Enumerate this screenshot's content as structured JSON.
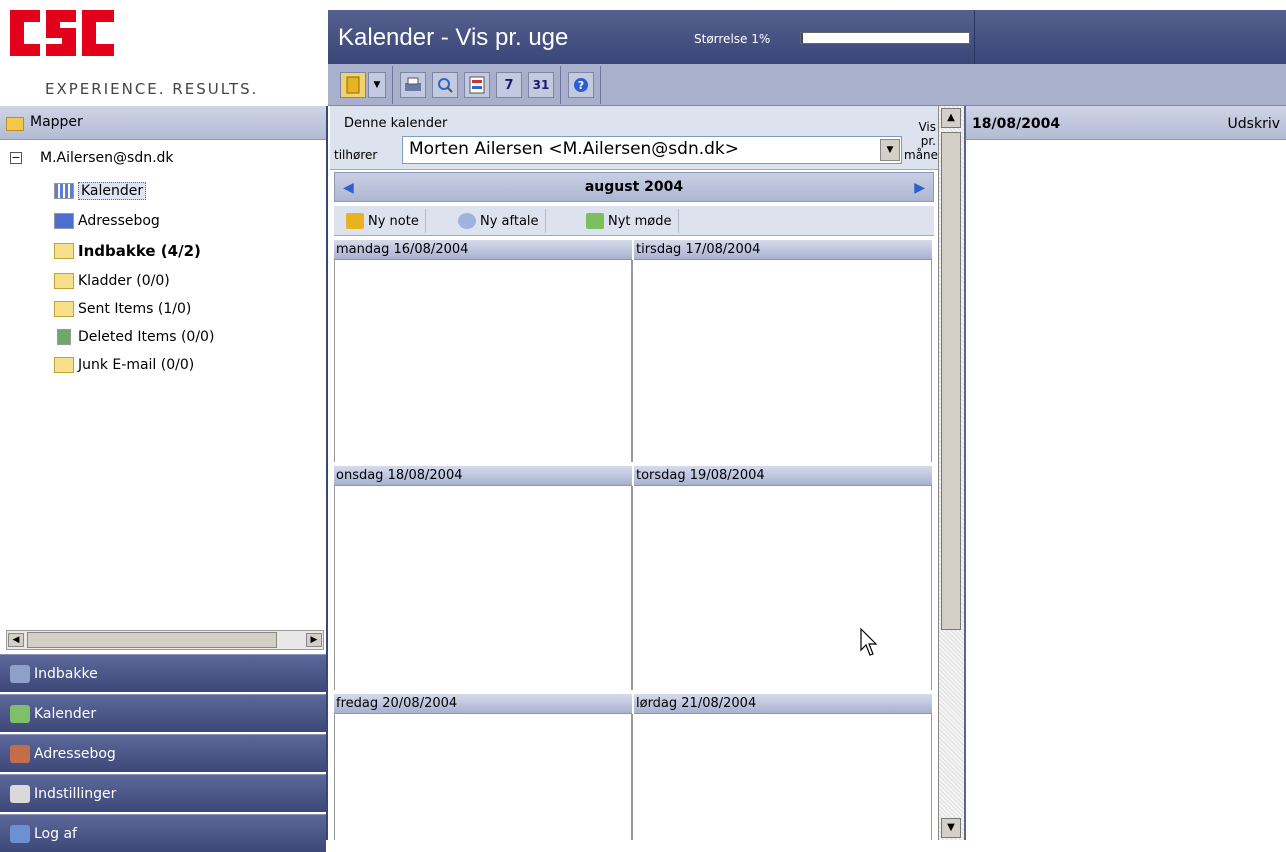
{
  "logo": {
    "tagline": "EXPERIENCE. RESULTS."
  },
  "header": {
    "title": "Kalender - Vis pr. uge",
    "size_label": "Størrelse 1%",
    "size_percent": 1
  },
  "sidebar": {
    "folders_label": "Mapper",
    "account": "M.Ailersen@sdn.dk",
    "items": [
      {
        "label": "Kalender",
        "icon": "calendar-icon"
      },
      {
        "label": "Adressebog",
        "icon": "addressbook-icon"
      },
      {
        "label": "Indbakke (4/2)",
        "icon": "mail-folder-icon"
      },
      {
        "label": "Kladder (0/0)",
        "icon": "mail-folder-icon"
      },
      {
        "label": "Sent Items (1/0)",
        "icon": "mail-folder-icon"
      },
      {
        "label": "Deleted Items (0/0)",
        "icon": "recycle-icon"
      },
      {
        "label": "Junk E-mail (0/0)",
        "icon": "mail-folder-icon"
      }
    ],
    "nav": [
      {
        "label": "Indbakke"
      },
      {
        "label": "Kalender"
      },
      {
        "label": "Adressebog"
      },
      {
        "label": "Indstillinger"
      },
      {
        "label": "Log af"
      }
    ]
  },
  "owner": {
    "line1": "Denne kalender",
    "line2": "tilhører",
    "selected": "Morten Ailersen <M.Ailersen@sdn.dk>",
    "vis_pr": "Vis pr.",
    "maaned": "måned"
  },
  "calendar": {
    "month": "august 2004",
    "actions": {
      "note": "Ny note",
      "appointment": "Ny aftale",
      "meeting": "Nyt møde"
    },
    "days": [
      "mandag 16/08/2004",
      "tirsdag 17/08/2004",
      "onsdag 18/08/2004",
      "torsdag 19/08/2004",
      "fredag 20/08/2004",
      "lørdag 21/08/2004"
    ]
  },
  "detail": {
    "date": "18/08/2004",
    "print": "Udskriv"
  },
  "colors": {
    "brand_red": "#e3001b",
    "header_blue": "#3a4678"
  }
}
